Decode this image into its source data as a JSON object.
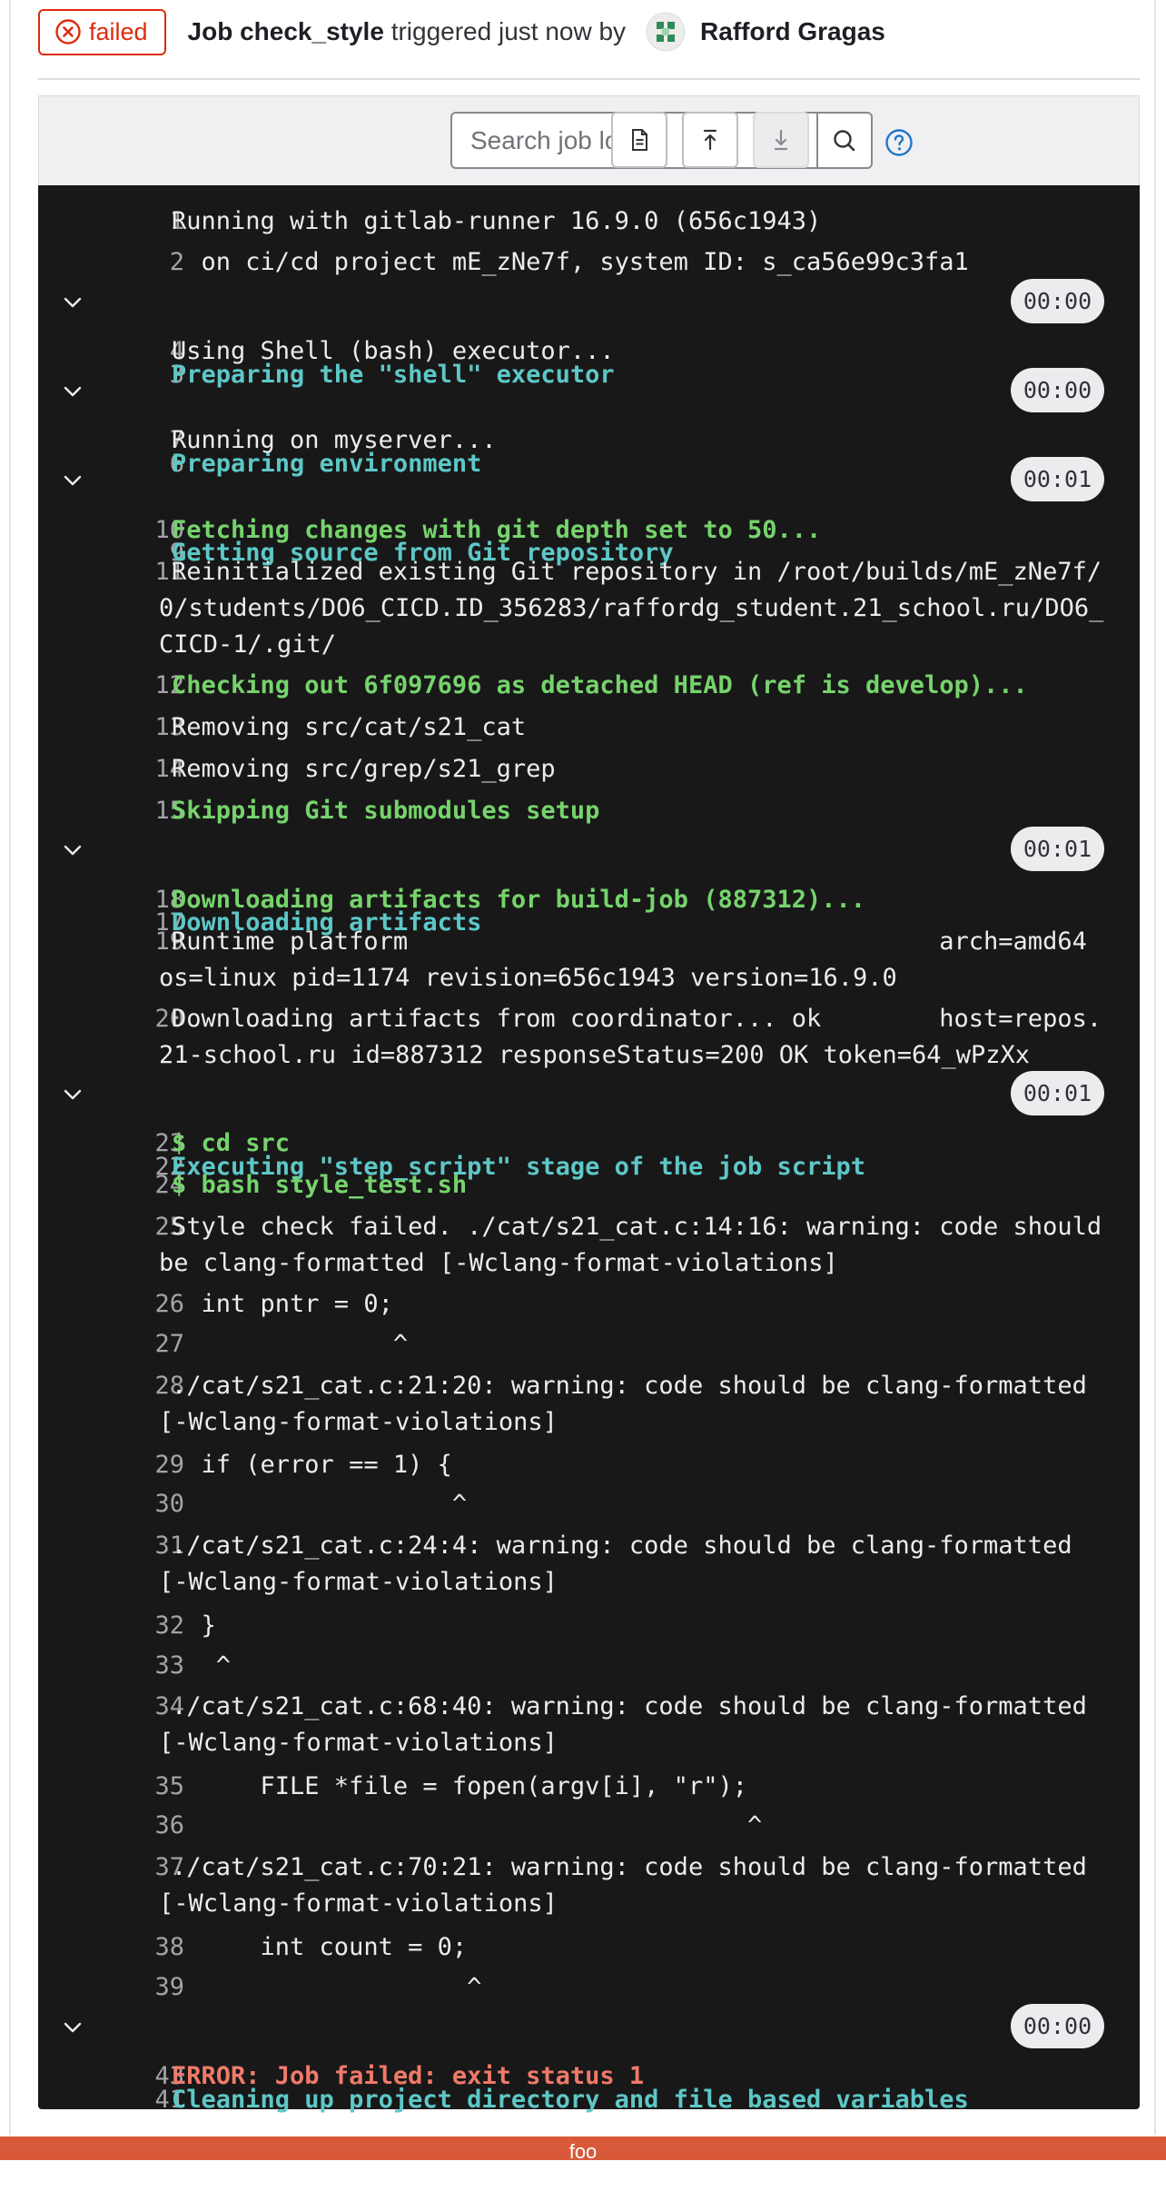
{
  "header": {
    "status": "failed",
    "job_prefix": "Job",
    "job_name": "check_style",
    "triggered_text": "triggered just now by",
    "user_name": "Rafford Gragas"
  },
  "toolbar": {
    "search_placeholder": "Search job log"
  },
  "log": {
    "lines": [
      {
        "n": "1",
        "t": "Running with gitlab-runner 16.9.0 (656c1943)"
      },
      {
        "n": "2",
        "t": "  on ci/cd project mE_zNe7f, system ID: s_ca56e99c3fa1"
      },
      {
        "n": "3",
        "t": "Preparing the \"shell\" executor",
        "dur": "00:00"
      },
      {
        "n": "4",
        "t": "Using Shell (bash) executor..."
      },
      {
        "n": "6",
        "t": "Preparing environment",
        "dur": "00:00"
      },
      {
        "n": "7",
        "t": "Running on myserver..."
      },
      {
        "n": "9",
        "t": "Getting source from Git repository",
        "dur": "00:01"
      },
      {
        "n": "10",
        "t": "Fetching changes with git depth set to 50..."
      },
      {
        "n": "11",
        "t": "Reinitialized existing Git repository in /root/builds/mE_zNe7f/0/students/DO6_CICD.ID_356283/raffordg_student.21_school.ru/DO6_CICD-1/.git/"
      },
      {
        "n": "12",
        "t": "Checking out 6f097696 as detached HEAD (ref is develop)..."
      },
      {
        "n": "13",
        "t": "Removing src/cat/s21_cat"
      },
      {
        "n": "14",
        "t": "Removing src/grep/s21_grep"
      },
      {
        "n": "15",
        "t": "Skipping Git submodules setup"
      },
      {
        "n": "17",
        "t": "Downloading artifacts",
        "dur": "00:01"
      },
      {
        "n": "18",
        "t": "Downloading artifacts for build-job (887312)..."
      },
      {
        "n": "19",
        "t": "Runtime platform                                    arch=amd64 os=linux pid=1174 revision=656c1943 version=16.9.0"
      },
      {
        "n": "20",
        "t": "Downloading artifacts from coordinator... ok        host=repos.21-school.ru id=887312 responseStatus=200 OK token=64_wPzXx"
      },
      {
        "n": "22",
        "t": "Executing \"step_script\" stage of the job script",
        "dur": "00:01"
      },
      {
        "n": "23",
        "t": "$ cd src"
      },
      {
        "n": "24",
        "t": "$ bash style_test.sh"
      },
      {
        "n": "25",
        "t": "Style check failed. ./cat/s21_cat.c:14:16: warning: code should be clang-formatted [-Wclang-format-violations]"
      },
      {
        "n": "26",
        "t": "  int pntr = 0;"
      },
      {
        "n": "27",
        "t": "               ^"
      },
      {
        "n": "28",
        "t": "./cat/s21_cat.c:21:20: warning: code should be clang-formatted [-Wclang-format-violations]"
      },
      {
        "n": "29",
        "t": "  if (error == 1) {"
      },
      {
        "n": "30",
        "t": "                   ^"
      },
      {
        "n": "31",
        "t": "./cat/s21_cat.c:24:4: warning: code should be clang-formatted [-Wclang-format-violations]"
      },
      {
        "n": "32",
        "t": "  }"
      },
      {
        "n": "33",
        "t": "   ^"
      },
      {
        "n": "34",
        "t": "./cat/s21_cat.c:68:40: warning: code should be clang-formatted [-Wclang-format-violations]"
      },
      {
        "n": "35",
        "t": "      FILE *file = fopen(argv[i], \"r\");"
      },
      {
        "n": "36",
        "t": "                                       ^"
      },
      {
        "n": "37",
        "t": "./cat/s21_cat.c:70:21: warning: code should be clang-formatted [-Wclang-format-violations]"
      },
      {
        "n": "38",
        "t": "      int count = 0;"
      },
      {
        "n": "39",
        "t": "                    ^"
      },
      {
        "n": "41",
        "t": "Cleaning up project directory and file based variables",
        "dur": "00:00"
      },
      {
        "n": "43",
        "t": "ERROR: Job failed: exit status 1"
      }
    ]
  },
  "footer": {
    "text": "foo"
  }
}
